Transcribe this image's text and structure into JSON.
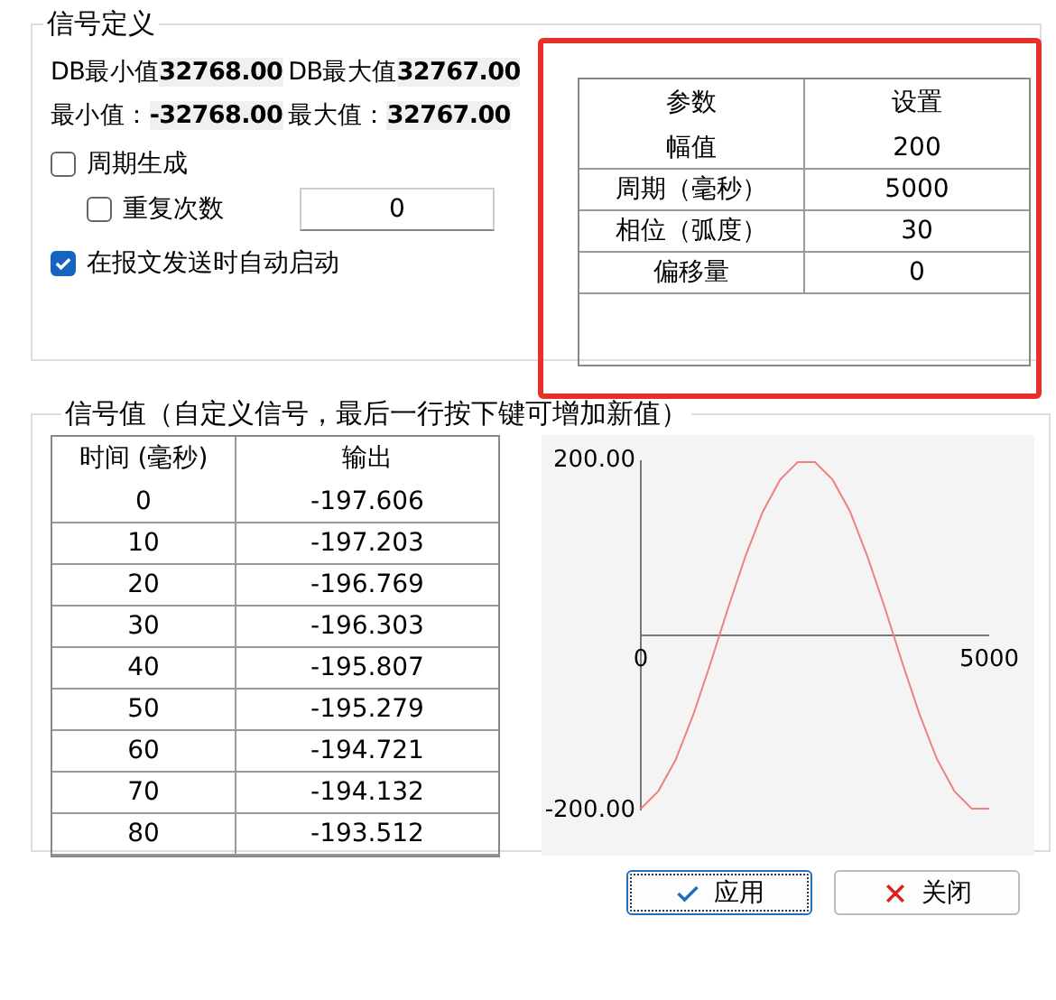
{
  "signal_definition": {
    "title": "信号定义",
    "db_min": {
      "label": "DB最小值",
      "value": "32768.00"
    },
    "db_max": {
      "label": "DB最大值",
      "value": "32767.00"
    },
    "min": {
      "label": "最小值：",
      "value": "-32768.00"
    },
    "max": {
      "label": "最大值：",
      "value": "32767.00"
    },
    "periodic": {
      "label": "周期生成",
      "checked": false
    },
    "repeat": {
      "label": "重复次数",
      "checked": false,
      "value": "0"
    },
    "auto_start": {
      "label": "在报文发送时自动启动",
      "checked": true
    },
    "params": {
      "columns": [
        "参数",
        "设置"
      ],
      "rows": [
        [
          "幅值",
          "200"
        ],
        [
          "周期（毫秒）",
          "5000"
        ],
        [
          "相位（弧度）",
          "30"
        ],
        [
          "偏移量",
          "0"
        ]
      ]
    }
  },
  "signal_values": {
    "title": "信号值（自定义信号，最后一行按下键可增加新值）",
    "columns": [
      "时间 (毫秒)",
      "输出"
    ],
    "rows": [
      [
        "0",
        "-197.606"
      ],
      [
        "10",
        "-197.203"
      ],
      [
        "20",
        "-196.769"
      ],
      [
        "30",
        "-196.303"
      ],
      [
        "40",
        "-195.807"
      ],
      [
        "50",
        "-195.279"
      ],
      [
        "60",
        "-194.721"
      ],
      [
        "70",
        "-194.132"
      ],
      [
        "80",
        "-193.512"
      ]
    ],
    "chart_data": {
      "type": "line",
      "x": [
        0,
        250,
        500,
        750,
        1000,
        1250,
        1500,
        1750,
        2000,
        2250,
        2500,
        2750,
        3000,
        3250,
        3500,
        3750,
        4000,
        4250,
        4500,
        4750,
        5000
      ],
      "series": [
        {
          "color": "#f08080",
          "values": [
            -198,
            -178,
            -142,
            -91,
            -32,
            31,
            90,
            141,
            178,
            198,
            198,
            178,
            142,
            91,
            32,
            -31,
            -90,
            -141,
            -178,
            -198,
            -198
          ]
        }
      ],
      "xlim": [
        0,
        5000
      ],
      "ylim": [
        -200,
        200
      ],
      "xticks": [
        0,
        5000
      ],
      "yticks": [
        {
          "value": -200,
          "label": "-200.00"
        },
        {
          "value": 200,
          "label": "200.00"
        }
      ]
    }
  },
  "buttons": [
    {
      "label": "应用",
      "kind": "apply"
    },
    {
      "label": "关闭",
      "kind": "close"
    }
  ]
}
